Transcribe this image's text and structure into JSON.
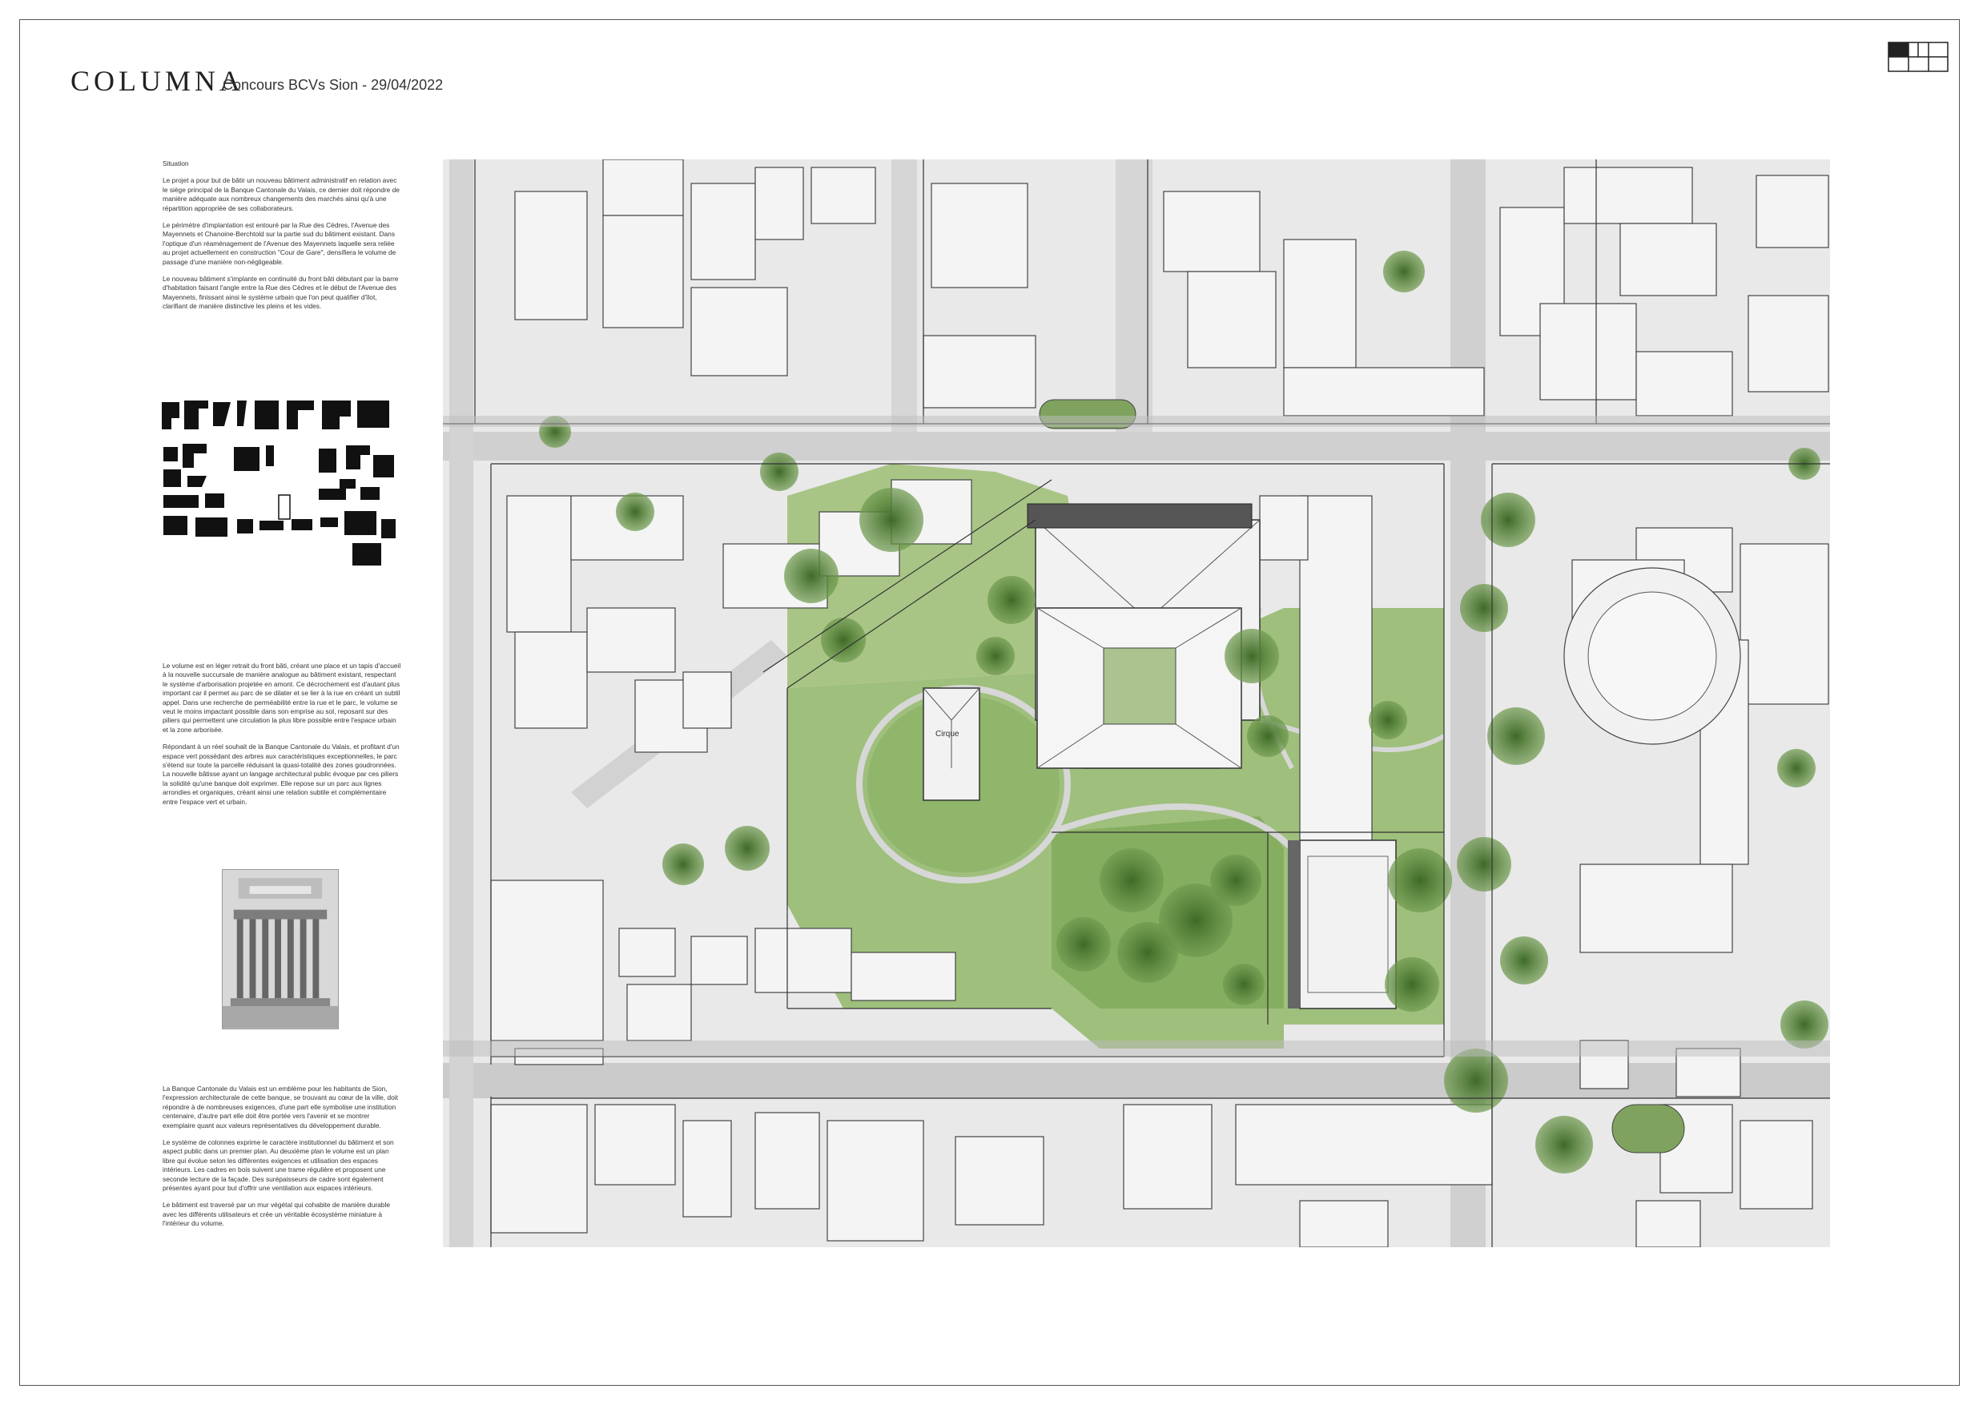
{
  "header": {
    "logo": "COLUMNA",
    "subtitle": "Concours BCVs Sion - 29/04/2022"
  },
  "intro": {
    "heading": "Situation",
    "paragraphs": [
      "Le projet a pour but de bâtir un nouveau bâtiment administratif en relation avec le siège principal de la Banque Cantonale du Valais, ce dernier doit répondre de manière adéquate aux nombreux changements des marchés ainsi qu'à une répartition appropriée de ses collaborateurs.",
      "Le périmètre d'implantation est entouré par la Rue des Cèdres, l'Avenue des Mayennets et Chanoine-Berchtold sur la partie sud du bâtiment existant. Dans l'optique d'un réaménagement de l'Avenue des Mayennets laquelle sera reliée au projet actuellement en construction \"Cour de Gare\", densifiera le volume de passage d'une manière non-négligeable.",
      "Le nouveau bâtiment s'implante en continuité du front bâti débutant par la barre d'habitation faisant l'angle entre la Rue des Cèdres et le début de l'Avenue des Mayennets, finissant ainsi le système urbain que l'on peut qualifier d'îlot, clarifiant de manière distinctive les pleins et les vides."
    ]
  },
  "concept": {
    "paragraphs": [
      "Le volume est en léger retrait du front bâti, créant une place et un tapis d'accueil à la nouvelle succursale de manière analogue au bâtiment existant, respectant le système d'arborisation projetée en amont. Ce décrochement est d'autant plus important car il permet au parc de se dilater et se lier à la rue en créant un subtil appel. Dans une recherche de perméabilité entre la rue et le parc, le volume se veut le moins impactant possible dans son emprise au sol, reposant sur des piliers qui permettent une circulation la plus libre possible entre l'espace urbain et la zone arborisée.",
      "Répondant à un réel souhait de la Banque Cantonale du Valais, et profitant d'un espace vert possédant des arbres aux caractéristiques exceptionnelles, le parc s'étend sur toute la parcelle réduisant la quasi-totalité des zones goudronnées. La nouvelle bâtisse ayant un langage architectural public évoque par ces piliers la solidité qu'une banque doit exprimer. Elle repose sur un parc aux lignes arrondies et organiques, créant ainsi une relation subtile et complémentaire entre l'espace vert et urbain."
    ]
  },
  "architecture": {
    "paragraphs": [
      "La Banque Cantonale du Valais est un emblème pour les habitants de Sion, l'expression architecturale de cette banque, se trouvant au cœur de la ville, doit répondre à de nombreuses exigences, d'une part elle symbolise une institution centenaire, d'autre part elle doit être portée vers l'avenir et se montrer exemplaire quant aux valeurs représentatives du développement durable.",
      "Le système de colonnes exprime le caractère institutionnel du bâtiment et son aspect public dans un premier plan. Au deuxième plan le volume est un plan libre qui évolue selon les différentes exigences et utilisation des espaces intérieurs. Les cadres en bois suivent une trame régulière et proposent une seconde lecture de la façade. Des surépaisseurs de cadre sont également présentes ayant pour but d'offrir une ventilation aux espaces intérieurs.",
      "Le bâtiment est traversé par un mur végétal qui cohabite de manière durable avec les différents utilisateurs et crée un véritable écosystème miniature à l'intérieur du volume."
    ]
  },
  "plan": {
    "label": "Cirque"
  },
  "colors": {
    "building": "#f3f3f3",
    "road": "#cdcdcd",
    "green": "#8db36b",
    "tree": "#4e7a34",
    "black": "#111111"
  }
}
